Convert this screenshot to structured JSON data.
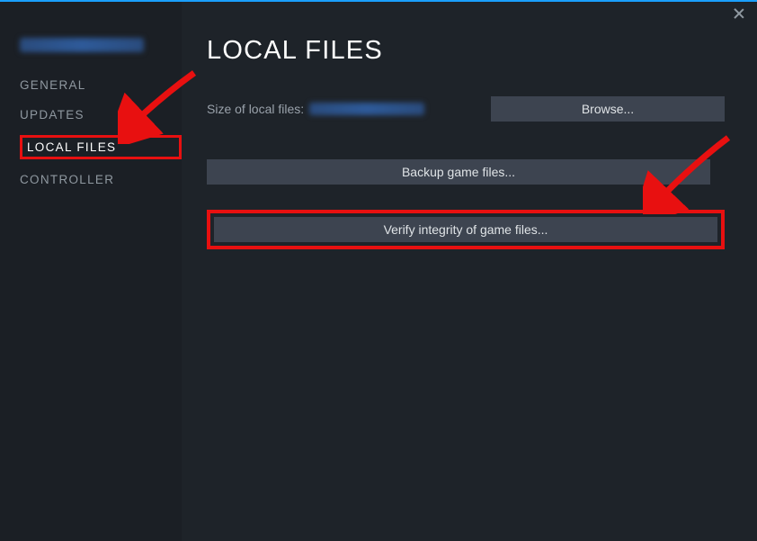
{
  "header": {
    "title": "LOCAL FILES"
  },
  "sidebar": {
    "items": [
      {
        "label": "GENERAL",
        "selected": false
      },
      {
        "label": "UPDATES",
        "selected": false
      },
      {
        "label": "LOCAL FILES",
        "selected": true
      },
      {
        "label": "CONTROLLER",
        "selected": false
      }
    ]
  },
  "main": {
    "size_label": "Size of local files:",
    "browse_label": "Browse...",
    "backup_label": "Backup game files...",
    "verify_label": "Verify integrity of game files..."
  },
  "annotations": {
    "highlight_color": "#e81010",
    "arrows": [
      "sidebar-local-files",
      "verify-button"
    ]
  }
}
